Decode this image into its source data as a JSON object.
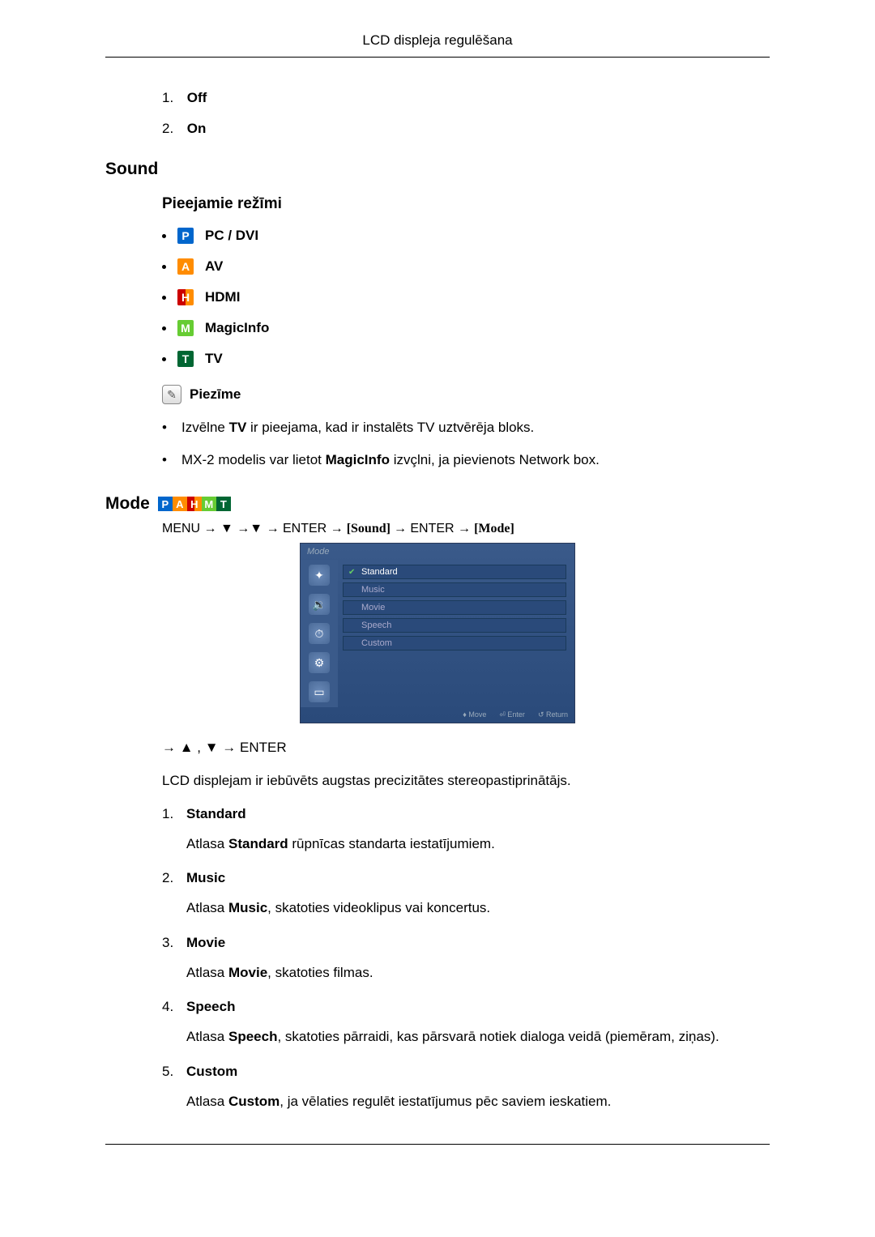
{
  "header": {
    "title": "LCD displeja regulēšana"
  },
  "top_list": [
    {
      "num": "1.",
      "label": "Off"
    },
    {
      "num": "2.",
      "label": "On"
    }
  ],
  "sound": {
    "heading": "Sound",
    "modes_heading": "Pieejamie režīmi",
    "modes": [
      {
        "badge": "P",
        "color": "p-icon",
        "label": "PC / DVI"
      },
      {
        "badge": "A",
        "color": "a-icon",
        "label": "AV"
      },
      {
        "badge": "H",
        "color": "h-icon",
        "label": "HDMI"
      },
      {
        "badge": "M",
        "color": "m-icon",
        "label": "MagicInfo"
      },
      {
        "badge": "T",
        "color": "t-icon",
        "label": "TV"
      }
    ],
    "note_label": "Piezīme",
    "notes": [
      {
        "pre": "Izvēlne ",
        "bold": "TV",
        "post": " ir pieejama, kad ir instalēts TV uztvērēja bloks."
      },
      {
        "pre": "MX-2 modelis var lietot ",
        "bold": "MagicInfo",
        "post": " izvçlni, ja pievienots Network box."
      }
    ]
  },
  "mode": {
    "heading": "Mode",
    "badges": [
      "P",
      "A",
      "H",
      "M",
      "T"
    ],
    "badge_colors": [
      "p-icon",
      "a-icon",
      "h-icon",
      "m-icon",
      "t-icon"
    ],
    "nav": {
      "parts": [
        "MENU → ▼ →▼ → ENTER → ",
        "[Sound]",
        " → ENTER → ",
        "[Mode]"
      ]
    },
    "osd": {
      "title": "Mode",
      "items": [
        "Standard",
        "Music",
        "Movie",
        "Speech",
        "Custom"
      ],
      "selected_index": 0,
      "footer": [
        "♦ Move",
        "⏎ Enter",
        "↺ Return"
      ]
    },
    "below_nav": "→ ▲ , ▼ → ENTER",
    "intro": "LCD displejam ir iebūvēts augstas precizitātes stereopastiprinātājs.",
    "items": [
      {
        "num": "1.",
        "title": "Standard",
        "body_pre": "Atlasa ",
        "body_bold": "Standard",
        "body_post": " rūpnīcas standarta iestatījumiem."
      },
      {
        "num": "2.",
        "title": "Music",
        "body_pre": "Atlasa ",
        "body_bold": "Music",
        "body_post": ", skatoties videoklipus vai koncertus."
      },
      {
        "num": "3.",
        "title": "Movie",
        "body_pre": "Atlasa ",
        "body_bold": "Movie",
        "body_post": ", skatoties filmas."
      },
      {
        "num": "4.",
        "title": "Speech",
        "body_pre": "Atlasa ",
        "body_bold": "Speech",
        "body_post": ", skatoties pārraidi, kas pārsvarā notiek dialoga veidā (piemēram, ziņas)."
      },
      {
        "num": "5.",
        "title": "Custom",
        "body_pre": "Atlasa ",
        "body_bold": "Custom",
        "body_post": ", ja vēlaties regulēt iestatījumus pēc saviem ieskatiem."
      }
    ]
  }
}
